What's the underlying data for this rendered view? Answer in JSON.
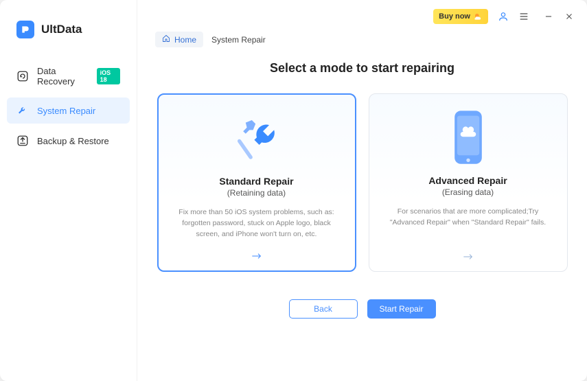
{
  "brand": {
    "name": "UltData"
  },
  "sidebar": {
    "items": [
      {
        "label": "Data Recovery",
        "badge": "iOS 18"
      },
      {
        "label": "System Repair"
      },
      {
        "label": "Backup & Restore"
      }
    ]
  },
  "titlebar": {
    "buy_label": "Buy now"
  },
  "breadcrumb": {
    "home": "Home",
    "current": "System Repair"
  },
  "heading": "Select a mode to start repairing",
  "cards": {
    "standard": {
      "title": "Standard Repair",
      "subtitle": "(Retaining data)",
      "desc": "Fix more than 50 iOS system problems, such as: forgotten password, stuck on Apple logo, black screen, and iPhone won't turn on, etc."
    },
    "advanced": {
      "title": "Advanced Repair",
      "subtitle": "(Erasing data)",
      "desc": "For scenarios that are more complicated;Try \"Advanced Repair\" when \"Standard Repair\" fails."
    }
  },
  "buttons": {
    "back": "Back",
    "start": "Start Repair"
  }
}
